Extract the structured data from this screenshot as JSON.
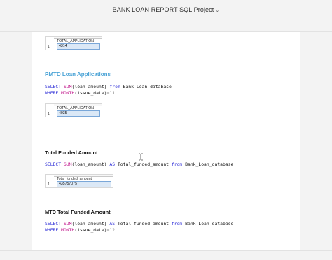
{
  "window": {
    "title": "BANK LOAN REPORT SQL Project",
    "title_chevron_icon": "chevron-down-icon"
  },
  "sections": [
    {
      "id": "total_applications_result",
      "result": {
        "column": "TOTAL_APPLICATION",
        "row_number": "1",
        "value": "4314"
      }
    },
    {
      "id": "pmtd_loan_applications",
      "heading": "PMTD Loan Applications",
      "sql_line1": {
        "kw1": "SELECT",
        "fn": "SUM",
        "rest": "(loan_amount) ",
        "kw2": "from",
        "table": " Bank_Loan_database"
      },
      "sql_line2": {
        "kw": "WHERE",
        "fn": "MONTH",
        "rest": "(issue_date)",
        "op": "=11"
      },
      "result": {
        "column": "TOTAL_APPLICATION",
        "row_number": "1",
        "value": "4035"
      }
    },
    {
      "id": "total_funded_amount",
      "heading": "Total Funded Amount",
      "sql_line1": {
        "kw1": "SELECT",
        "fn": "SUM",
        "rest": "(loan_amount) ",
        "kw_as": "AS",
        "alias": " Total_funded_amount ",
        "kw2": "from",
        "table": " Bank_Loan_database"
      },
      "result": {
        "column": "Total_funded_amount",
        "row_number": "1",
        "value": "435757075"
      }
    },
    {
      "id": "mtd_total_funded_amount",
      "heading": "MTD Total Funded Amount",
      "sql_line1": {
        "kw1": "SELECT",
        "fn": "SUM",
        "rest": "(loan_amount) ",
        "kw_as": "AS",
        "alias": " Total_funded_amount ",
        "kw2": "from",
        "table": " Bank_Loan_database"
      },
      "sql_line2": {
        "kw": "WHERE",
        "fn": "MONTH",
        "rest": "(issue_date)",
        "op": "=12"
      }
    }
  ]
}
